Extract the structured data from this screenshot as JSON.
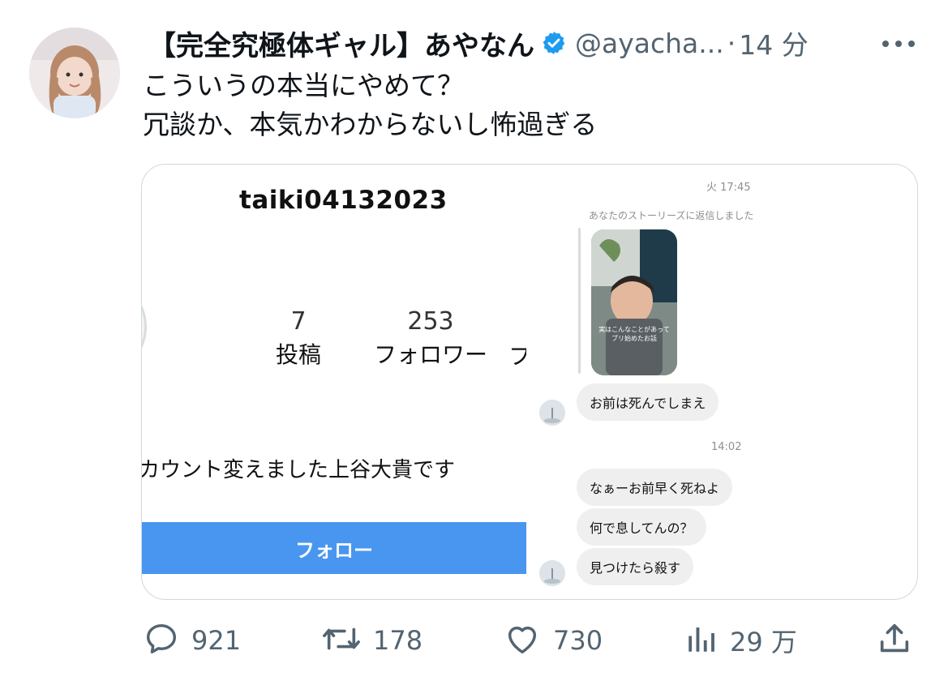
{
  "tweet": {
    "author": {
      "display_name": "【完全究極体ギャル】あやなん",
      "handle": "@ayacha...",
      "verified": true,
      "avatar_icon": "user-avatar-photo"
    },
    "separator": "·",
    "time": "14 分",
    "more_icon": "more-horizontal-icon",
    "text_lines": [
      "こういうの本当にやめて？",
      "冗談か、本気かわからないし怖過ぎる"
    ]
  },
  "media": {
    "profile": {
      "username": "taiki04132023",
      "posts_count": "7",
      "posts_label": "投稿",
      "followers_count": "253",
      "followers_label": "フォロワー",
      "following_label_partial": "フ",
      "bio": "カウント変えました上谷大貴です",
      "follow_button": "フォロー"
    },
    "dm": {
      "timestamp_1": "火 17:45",
      "story_reply_label": "あなたのストーリーズに返信しました",
      "story_caption_1": "実はこんなことがあって",
      "story_caption_2": "ブリ始めたお話",
      "message_1": "お前は死んでしまえ",
      "timestamp_2": "14:02",
      "message_2": "なぁーお前早く死ねよ",
      "message_3": "何で息してんの？",
      "message_4": "見つけたら殺す"
    }
  },
  "actions": {
    "reply": {
      "icon": "reply-icon",
      "count": "921"
    },
    "retweet": {
      "icon": "retweet-icon",
      "count": "178"
    },
    "like": {
      "icon": "heart-icon",
      "count": "730"
    },
    "views": {
      "icon": "views-icon",
      "count": "29 万"
    },
    "share": {
      "icon": "share-icon"
    }
  },
  "colors": {
    "verified": "#1d9bf0",
    "secondary_text": "#536471",
    "follow_button": "#4896f0",
    "bubble": "#efefef"
  }
}
